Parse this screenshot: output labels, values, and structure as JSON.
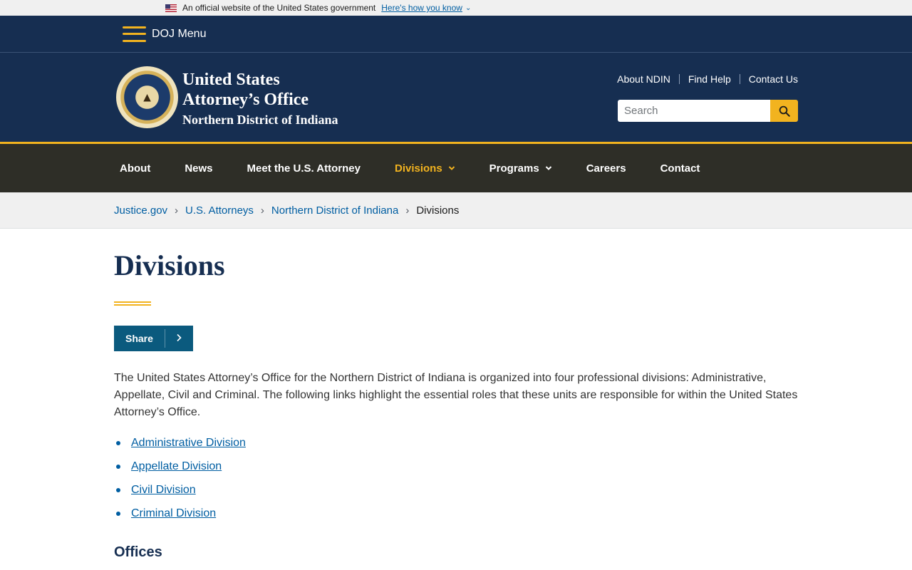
{
  "gov_banner": {
    "text": "An official website of the United States government",
    "link": "Here's how you know"
  },
  "doj_menu": {
    "label": "DOJ Menu"
  },
  "header": {
    "title_line1": "United States",
    "title_line2": "Attorney’s Office",
    "subtitle": "Northern District of Indiana",
    "util_links": [
      "About NDIN",
      "Find Help",
      "Contact Us"
    ],
    "search_placeholder": "Search"
  },
  "nav": {
    "items": [
      {
        "label": "About",
        "dropdown": false
      },
      {
        "label": "News",
        "dropdown": false
      },
      {
        "label": "Meet the U.S. Attorney",
        "dropdown": false
      },
      {
        "label": "Divisions",
        "dropdown": true,
        "active": true
      },
      {
        "label": "Programs",
        "dropdown": true
      },
      {
        "label": "Careers",
        "dropdown": false
      },
      {
        "label": "Contact",
        "dropdown": false
      }
    ]
  },
  "breadcrumb": {
    "items": [
      "Justice.gov",
      "U.S. Attorneys",
      "Northern District of Indiana"
    ],
    "current": "Divisions"
  },
  "content": {
    "title": "Divisions",
    "share_label": "Share",
    "intro": "The United States Attorney’s Office for the Northern District of Indiana is organized into four professional divisions: Administrative, Appellate, Civil and Criminal. The following links highlight the essential roles that these units are responsible for within the United States Attorney’s Office.",
    "divisions": [
      "Administrative Division",
      "Appellate Division",
      "Civil Division",
      "Criminal Division"
    ],
    "offices_heading": "Offices"
  },
  "colors": {
    "navy": "#162e51",
    "gold": "#f2b31f",
    "nav_bg": "#2e2e27",
    "link": "#005ea2",
    "share_bg": "#0b5a7e"
  }
}
